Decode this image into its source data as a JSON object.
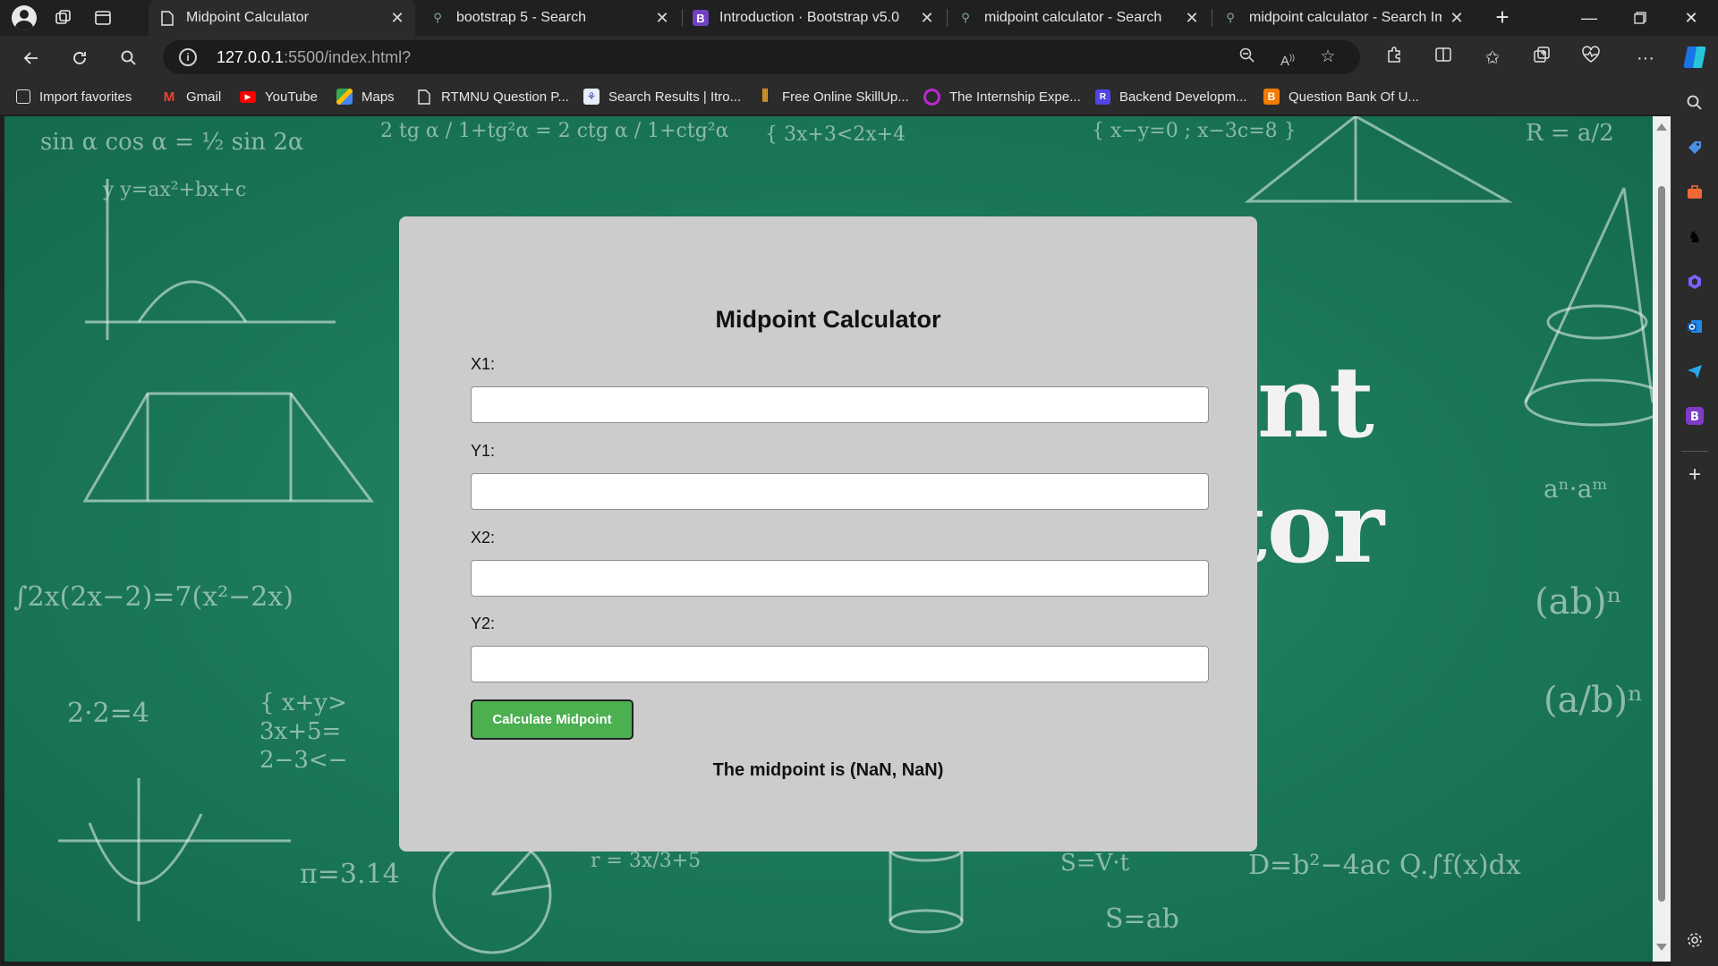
{
  "tabs": [
    {
      "title": "Midpoint Calculator",
      "icon": "page-icon",
      "active": true
    },
    {
      "title": "bootstrap 5 - Search",
      "icon": "search-icon",
      "active": false
    },
    {
      "title": "Introduction · Bootstrap v5.0",
      "icon": "bootstrap-icon",
      "active": false
    },
    {
      "title": "midpoint calculator - Search",
      "icon": "search-icon",
      "active": false
    },
    {
      "title": "midpoint calculator - Search Ima",
      "icon": "search-icon",
      "active": false
    }
  ],
  "address_bar": {
    "host": "127.0.0.1",
    "rest": ":5500/index.html?"
  },
  "favorites": [
    {
      "label": "Import favorites",
      "icon": "import-icon"
    },
    {
      "label": "Gmail",
      "icon": "gmail-icon"
    },
    {
      "label": "YouTube",
      "icon": "youtube-icon"
    },
    {
      "label": "Maps",
      "icon": "maps-icon"
    },
    {
      "label": "RTMNU Question P...",
      "icon": "document-icon"
    },
    {
      "label": "Search Results | Itro...",
      "icon": "site-icon"
    },
    {
      "label": "Free Online SkillUp...",
      "icon": "skillup-icon"
    },
    {
      "label": "The Internship Expe...",
      "icon": "circle-icon"
    },
    {
      "label": "Backend Developm...",
      "icon": "r-badge-icon"
    },
    {
      "label": "Question Bank Of U...",
      "icon": "blogger-icon"
    }
  ],
  "card": {
    "title": "Midpoint Calculator",
    "fields": [
      {
        "label": "X1:",
        "value": ""
      },
      {
        "label": "Y1:",
        "value": ""
      },
      {
        "label": "X2:",
        "value": ""
      },
      {
        "label": "Y2:",
        "value": ""
      }
    ],
    "button": "Calculate Midpoint",
    "result": "The midpoint is (NaN, NaN)"
  },
  "background_text": {
    "big1": "nt",
    "big2": "tor"
  },
  "colors": {
    "button_bg": "#4caf50",
    "card_bg": "#cccccc",
    "chalkboard": "#1d7a5c"
  }
}
